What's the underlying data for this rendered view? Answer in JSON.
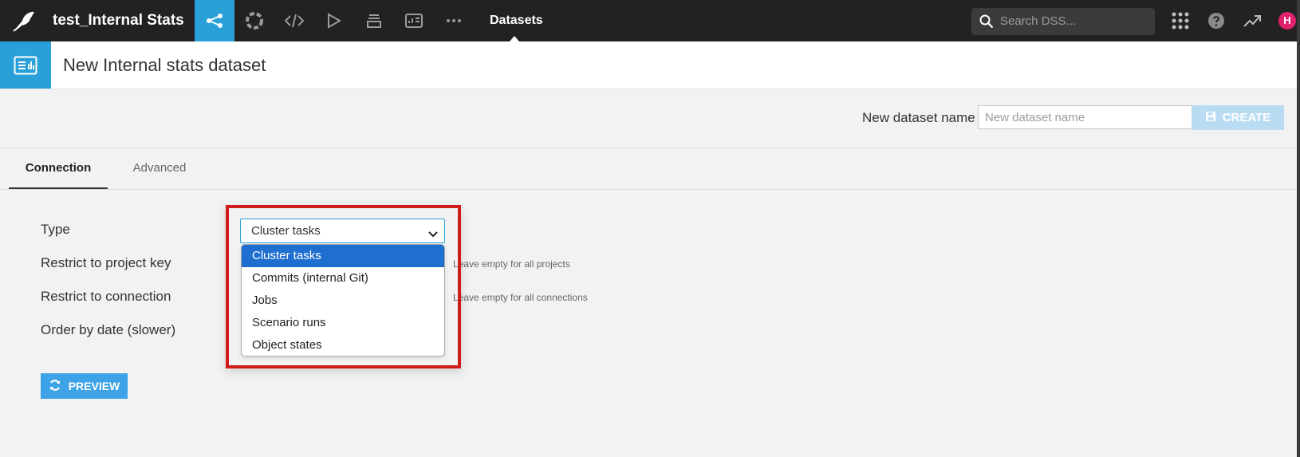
{
  "topbar": {
    "project_title": "test_Internal Stats",
    "current_section": "Datasets",
    "nav_icons": [
      "flow-icon",
      "lab-icon",
      "code-icon",
      "run-icon",
      "stack-icon",
      "dashboard-icon",
      "more-icon"
    ],
    "search_placeholder": "Search DSS...",
    "avatar_initial": "H"
  },
  "page": {
    "title": "New Internal stats dataset"
  },
  "name_row": {
    "label": "New dataset name",
    "input_placeholder": "New dataset name",
    "input_value": "",
    "create_label": "CREATE"
  },
  "tabs": [
    {
      "label": "Connection",
      "active": true
    },
    {
      "label": "Advanced",
      "active": false
    }
  ],
  "form": {
    "type_label": "Type",
    "project_key_label": "Restrict to project key",
    "project_key_help": "Leave empty for all projects",
    "connection_label": "Restrict to connection",
    "connection_help": "Leave empty for all connections",
    "order_label": "Order by date (slower)",
    "type_selected": "Cluster tasks",
    "type_options": [
      "Cluster tasks",
      "Commits (internal Git)",
      "Jobs",
      "Scenario runs",
      "Object states"
    ],
    "preview_label": "PREVIEW"
  },
  "colors": {
    "accent": "#2aa0d8",
    "topbar_bg": "#222222",
    "create_disabled": "#b9dcf3",
    "preview_button": "#3da3e6",
    "selected_option": "#1f6fd0",
    "highlight_border": "#d11a1a",
    "avatar": "#e0206a"
  }
}
